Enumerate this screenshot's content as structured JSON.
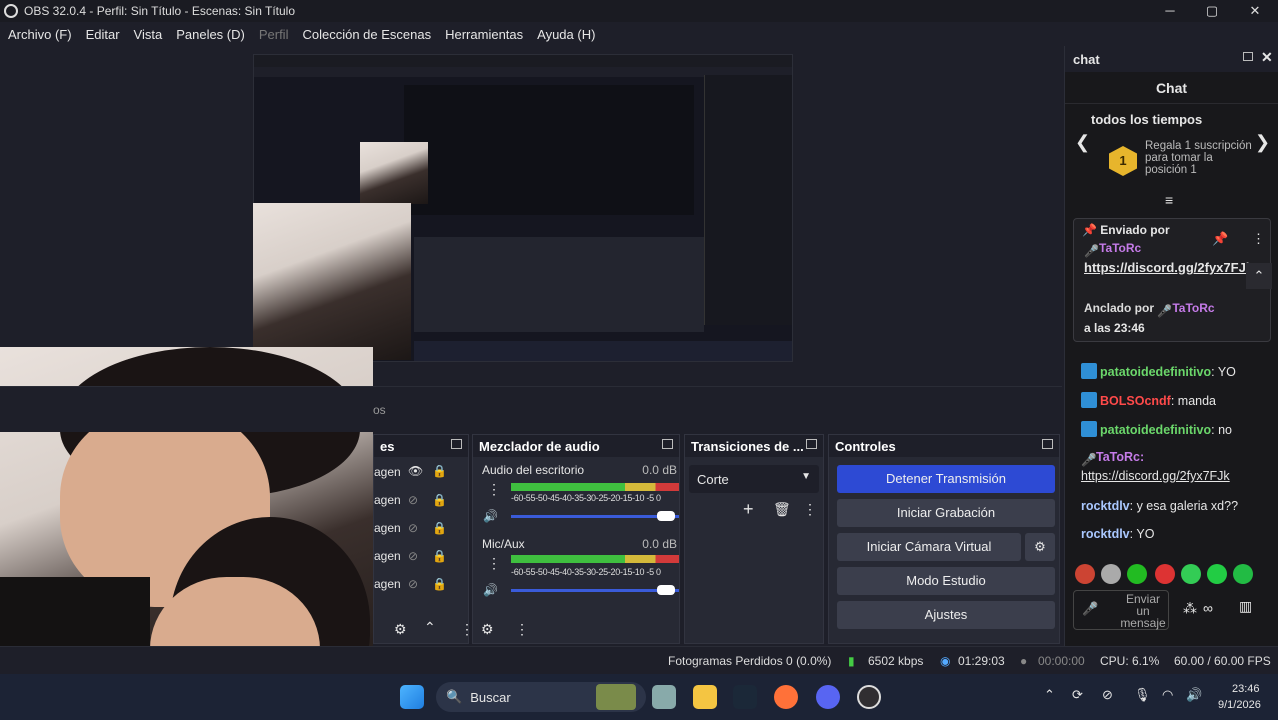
{
  "window": {
    "title": "OBS 32.0.4 - Perfil: Sin Título - Escenas: Sin Título",
    "controls": [
      "─",
      "▢",
      "✕"
    ]
  },
  "menu": [
    "Archivo (F)",
    "Editar",
    "Vista",
    "Paneles (D)",
    "Perfil",
    "Colección de Escenas",
    "Herramientas",
    "Ayuda (H)"
  ],
  "tabs_partial": "os",
  "sources": {
    "title_partial": "es",
    "items": [
      "agen",
      "agen",
      "agen",
      "agen",
      "agen"
    ]
  },
  "mixer": {
    "title": "Mezclador de audio",
    "channels": [
      {
        "name": "Audio del escritorio",
        "db": "0.0 dB"
      },
      {
        "name": "Mic/Aux",
        "db": "0.0 dB"
      }
    ],
    "scale": "-60-55-50-45-40-35-30-25-20-15-10 -5  0"
  },
  "transitions": {
    "title": "Transiciones de ...",
    "selected": "Corte"
  },
  "controls": {
    "title": "Controles",
    "stop_stream": "Detener Transmisión",
    "start_recording": "Iniciar Grabación",
    "virtual_cam": "Iniciar Cámara Virtual",
    "studio_mode": "Modo Estudio",
    "settings": "Ajustes"
  },
  "status": {
    "dropped": "Fotogramas Perdidos 0 (0.0%)",
    "bitrate": "6502 kbps",
    "live_time": "01:29:03",
    "rec_time": "00:00:00",
    "cpu": "CPU: 6.1%",
    "fps": "60.00 / 60.00 FPS"
  },
  "chat": {
    "dock_title": "chat",
    "title": "Chat",
    "leaderboard_period": "todos los tiempos",
    "rank": "1",
    "leaderboard_text": "Regala 1 suscripción para tomar la posición 1",
    "pinned": {
      "sent_by": "Enviado por",
      "user": "TaToRc",
      "link": "https://discord.gg/2fyx7FJk",
      "pinned_by_label": "Anclado por",
      "pinned_by": "TaToRc",
      "time": "a las 23:46"
    },
    "messages": [
      {
        "user": "patatoidedefinitivo",
        "text": ": YO"
      },
      {
        "user": "BOLSOcndf",
        "text": ": manda"
      },
      {
        "user": "patatoidedefinitivo",
        "text": ": no"
      },
      {
        "user": "TaToRc:",
        "text": "https://discord.gg/2fyx7FJk"
      },
      {
        "user": "rocktdlv",
        "text": ": y esa galeria xd??"
      },
      {
        "user": "rocktdlv",
        "text": ": YO"
      }
    ],
    "send_placeholder": "Enviar un mensaje"
  },
  "taskbar": {
    "search": "Buscar",
    "time": "23:46",
    "date": "9/1/2026"
  },
  "colors": {
    "primary_button": "#2d4ad4",
    "bg": "#1e1f29",
    "chat_bg": "#18181b"
  }
}
